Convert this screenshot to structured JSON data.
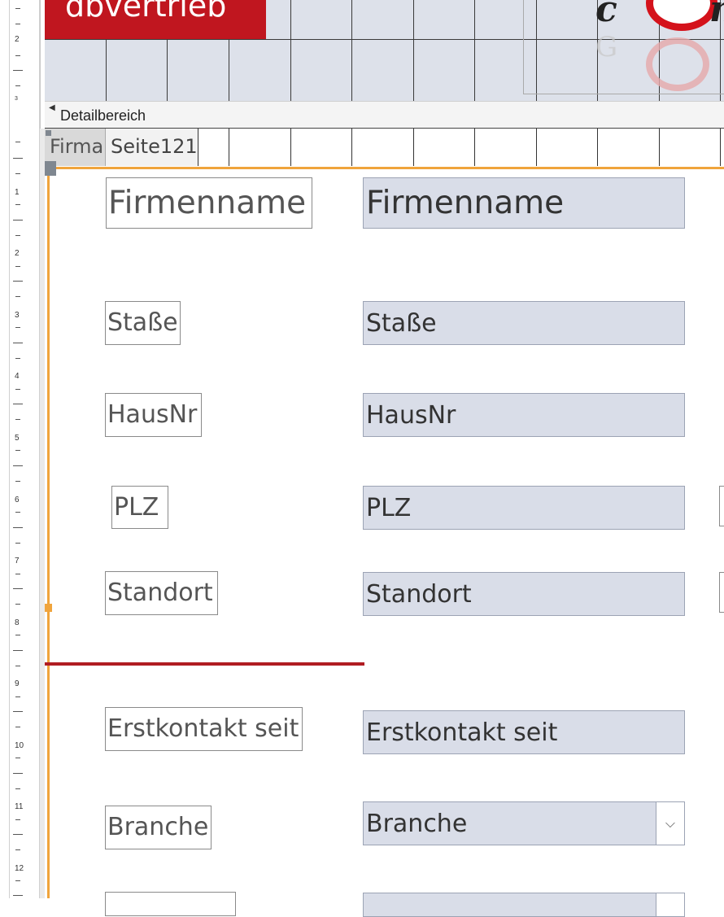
{
  "brand": {
    "title": "dbvertrieb",
    "color": "#c0161f"
  },
  "logo": {
    "text": "c",
    "text2": "n",
    "reflect_text": "G"
  },
  "ruler": {
    "numbers": [
      "2",
      "3",
      "1",
      "2",
      "3",
      "4",
      "5",
      "6",
      "7",
      "8",
      "9",
      "10",
      "11",
      "12"
    ]
  },
  "section": {
    "title": "Detailbereich"
  },
  "tabs": [
    {
      "label": "Firma"
    },
    {
      "label": "Seite121"
    }
  ],
  "form": {
    "rows": [
      {
        "label": "Firmenname",
        "field": "Firmenname"
      },
      {
        "label": "Staße",
        "field": "Staße"
      },
      {
        "label": "HausNr",
        "field": "HausNr"
      },
      {
        "label": "PLZ",
        "field": "PLZ"
      },
      {
        "label": "Standort",
        "field": "Standort"
      },
      {
        "label": "Erstkontakt seit",
        "field": "Erstkontakt seit"
      },
      {
        "label": "Branche",
        "field": "Branche"
      }
    ],
    "combo_icon": "chevron-down-icon",
    "chevron": "⌵"
  },
  "colors": {
    "accent_orange": "#f0a43c",
    "divider_red": "#b01c22",
    "field_bg": "#d9dde8"
  }
}
